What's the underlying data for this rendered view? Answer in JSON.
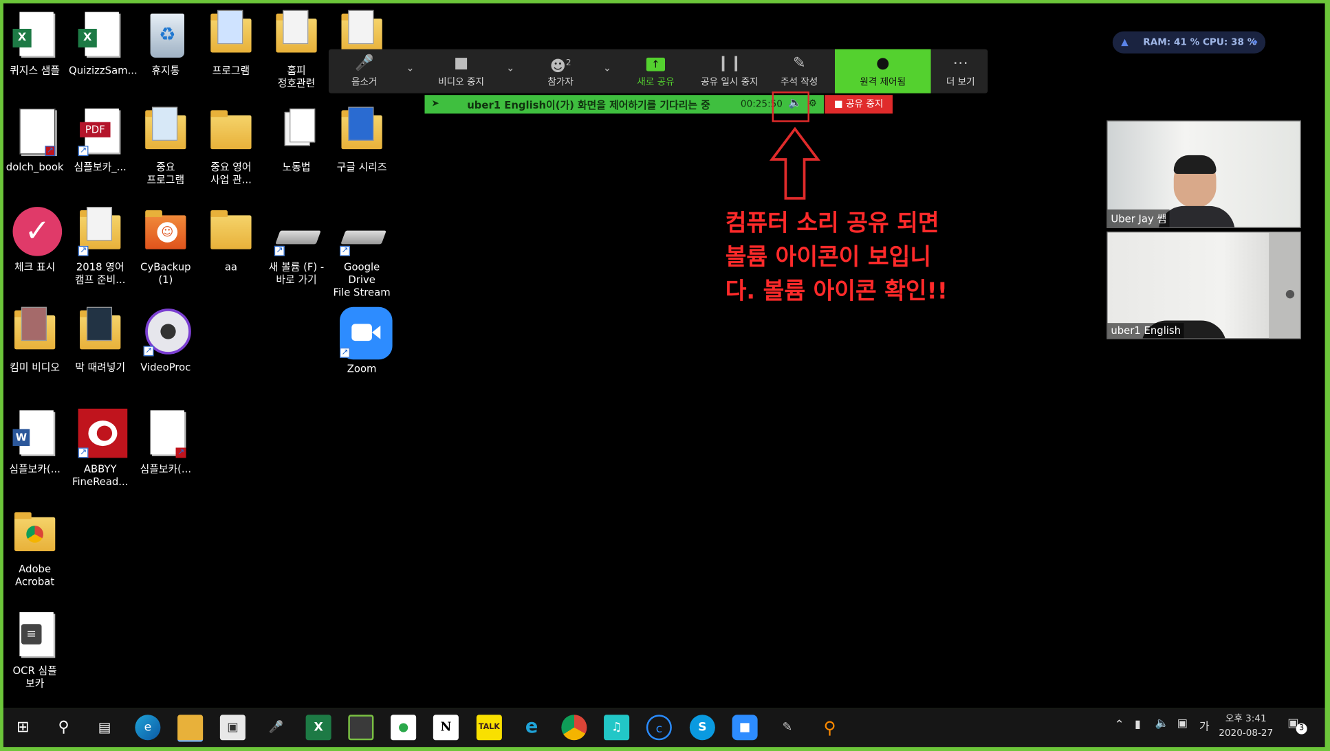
{
  "desktop": {
    "icons": [
      {
        "label": "퀴지스 샘플"
      },
      {
        "label": "QuizizzSam..."
      },
      {
        "label": "휴지통"
      },
      {
        "label": "프로그램"
      },
      {
        "label": "홈피\n정호관련"
      },
      {
        "label": ""
      },
      {
        "label": "dolch_book"
      },
      {
        "label": "심플보카_..."
      },
      {
        "label": "중요\n프로그램"
      },
      {
        "label": "중요 영어\n사업 관..."
      },
      {
        "label": "노동법"
      },
      {
        "label": "구글 시리즈"
      },
      {
        "label": "체크 표시"
      },
      {
        "label": "2018 영어\n캠프 준비..."
      },
      {
        "label": "CyBackup (1)"
      },
      {
        "label": "aa"
      },
      {
        "label": "새 볼륨 (F) -\n바로 가기"
      },
      {
        "label": "Google Drive\nFile Stream ..."
      },
      {
        "label": "킴미 비디오"
      },
      {
        "label": "막 때려넣기"
      },
      {
        "label": "VideoProc"
      },
      {
        "label": "Zoom"
      },
      {
        "label": "심플보카(..."
      },
      {
        "label": "ABBYY\nFineRead..."
      },
      {
        "label": "심플보카(..."
      },
      {
        "label": "Adobe\nAcrobat"
      },
      {
        "label": "OCR 심플\n보카"
      }
    ]
  },
  "toolbar": {
    "mute_label": "음소거",
    "video_label": "비디오 중지",
    "participants_label": "참가자",
    "participants_count": "2",
    "new_share_label": "새로 공유",
    "pause_share_label": "공유 일시 중지",
    "annotate_label": "주석 작성",
    "remote_control_label": "원격 제어됨",
    "more_label": "더 보기"
  },
  "share_bar": {
    "status_text": "uber1  English이(가) 화면을 제어하기를 기다리는 중",
    "timer": "00:25:50",
    "stop_label": "공유 중지"
  },
  "annotation": {
    "text": "컴퓨터 소리 공유 되면\n볼륨 아이콘이 보입니\n다. 볼륨 아이콘 확인!!",
    "color": "#ff2a2a"
  },
  "videos": [
    {
      "name": "Uber Jay 쌤"
    },
    {
      "name": "uber1 English"
    }
  ],
  "system_widget": {
    "text": "RAM: 41 %  CPU: 38 %"
  },
  "taskbar": {
    "time": "오후 3:41",
    "date": "2020-08-27",
    "ime": "가",
    "notification_count": "3"
  },
  "colors": {
    "frame": "#6cc63a",
    "remote_button": "#54d12f",
    "share_bar": "#3fbf3f",
    "stop_button": "#e02b2b"
  }
}
